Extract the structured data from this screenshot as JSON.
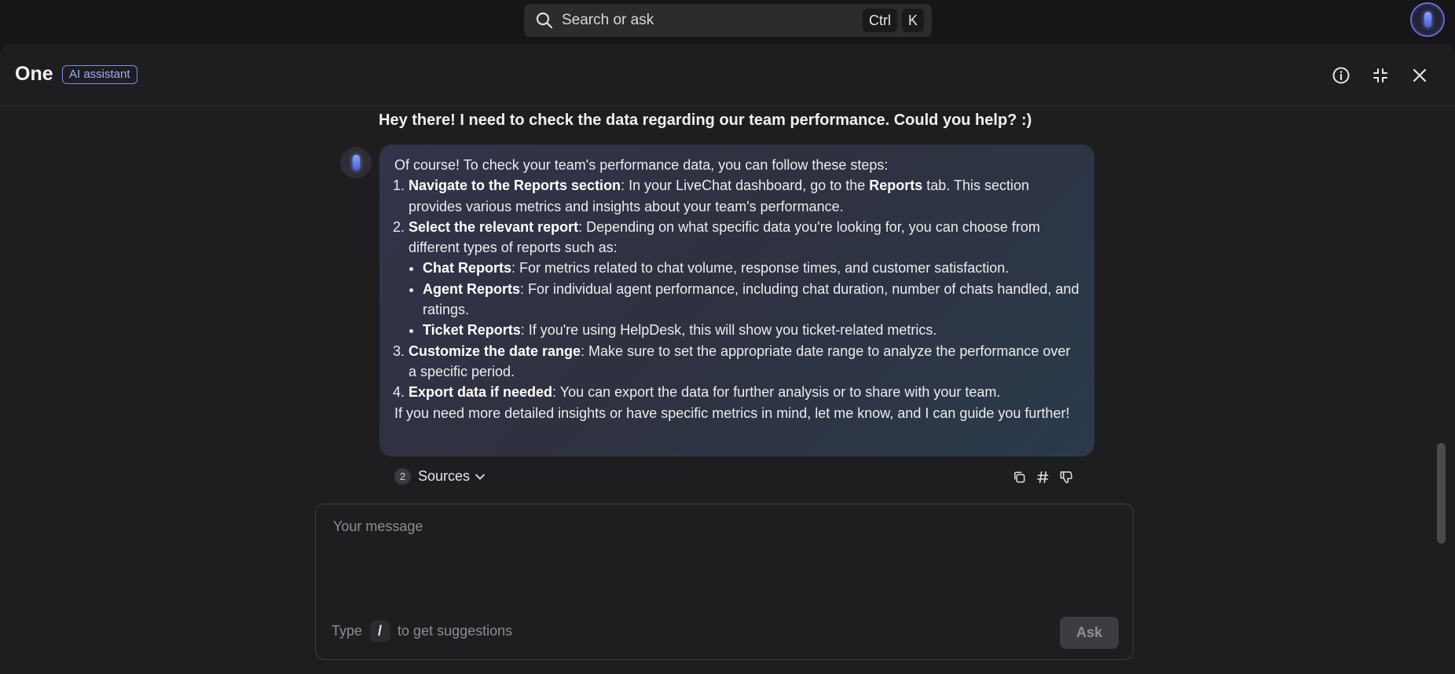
{
  "search": {
    "text": "Search or ask",
    "key1": "Ctrl",
    "key2": "K"
  },
  "header": {
    "title": "One",
    "badge": "AI assistant"
  },
  "icons": {
    "search": "search-icon",
    "info": "info-icon",
    "collapse": "collapse-icon",
    "close": "close-icon",
    "copy": "copy-icon",
    "hash": "hash-icon",
    "thumbs_down": "thumbs-down-icon"
  },
  "colors": {
    "accent": "#7c8fe6",
    "panel_bg": "#1e1e21",
    "page_bg": "#161618"
  },
  "conversation": {
    "user_message": "Hey there! I need to check the data regarding our team performance. Could you help? :)",
    "assistant": {
      "intro": "Of course! To check your team's performance data, you can follow these steps:",
      "step1": {
        "title": "Navigate to the Reports section",
        "text_a": ": In your LiveChat dashboard, go to the ",
        "bold": "Reports",
        "text_b": " tab. This section provides various metrics and insights about your team's performance."
      },
      "step2": {
        "title": "Select the relevant report",
        "text": ": Depending on what specific data you're looking for, you can choose from different types of reports such as:"
      },
      "reports": [
        {
          "name": "Chat Reports",
          "text": ": For metrics related to chat volume, response times, and customer satisfaction."
        },
        {
          "name": "Agent Reports",
          "text": ": For individual agent performance, including chat duration, number of chats handled, and ratings."
        },
        {
          "name": "Ticket Reports",
          "text": ": If you're using HelpDesk, this will show you ticket-related metrics."
        }
      ],
      "step3": {
        "title": "Customize the date range",
        "text": ": Make sure to set the appropriate date range to analyze the performance over a specific period."
      },
      "step4": {
        "title": "Export data if needed",
        "text": ": You can export the data for further analysis or to share with your team."
      },
      "outro": "If you need more detailed insights or have specific metrics in mind, let me know, and I can guide you further!"
    },
    "sources": {
      "count": "2",
      "label": "Sources"
    }
  },
  "composer": {
    "placeholder": "Your message",
    "hint_prefix": "Type",
    "hint_key": "/",
    "hint_suffix": "to get suggestions",
    "ask_label": "Ask"
  }
}
